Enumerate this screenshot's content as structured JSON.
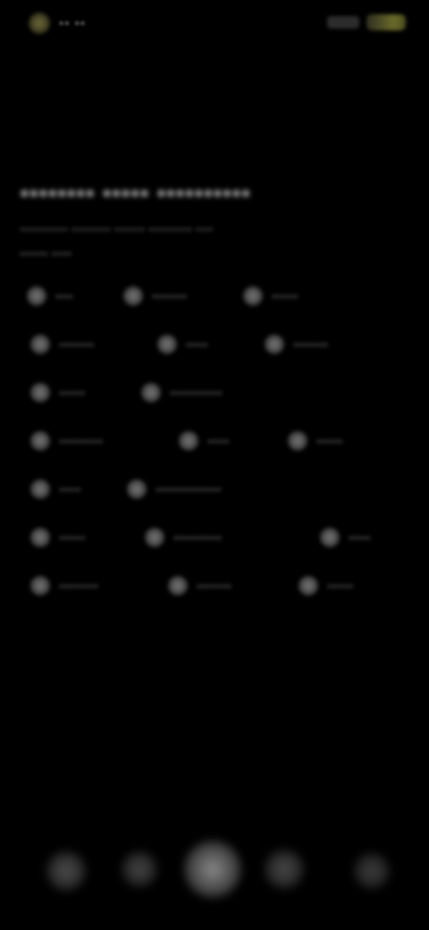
{
  "status_bar": {
    "time": "•• ••",
    "left_icon": "status-indicator-icon",
    "right_icons": [
      "signal-icon",
      "battery-icon"
    ],
    "battery_color": "#6a6a2a"
  },
  "main": {
    "title": "•••••••• ••••• ••••••••••",
    "subtitle": "••••••••••• ••••••••• ••••••• •••••••••• ••••",
    "section_label": "••••••• •••••",
    "chip_rows": [
      [
        {
          "label": "••••"
        },
        {
          "label": "••••••••"
        },
        {
          "label": "••••••"
        }
      ],
      [
        {
          "label": "••••••••"
        },
        {
          "label": "•••••"
        },
        {
          "label": "••••••••"
        }
      ],
      [
        {
          "label": "••••••"
        },
        {
          "label": "••••••••••••"
        }
      ],
      [
        {
          "label": "••••••••••"
        },
        {
          "label": "•••••"
        },
        {
          "label": "••••••"
        }
      ],
      [
        {
          "label": "•••••"
        },
        {
          "label": "•••••••••••••••"
        }
      ],
      [
        {
          "label": "••••••"
        },
        {
          "label": "•••••••••••"
        },
        {
          "label": "•••••"
        }
      ],
      [
        {
          "label": "•••••••••"
        },
        {
          "label": "••••••••"
        },
        {
          "label": "••••••"
        }
      ]
    ]
  },
  "dock": {
    "icons": [
      "phone-icon",
      "messages-icon",
      "camera-icon",
      "browser-icon",
      "apps-icon"
    ]
  }
}
